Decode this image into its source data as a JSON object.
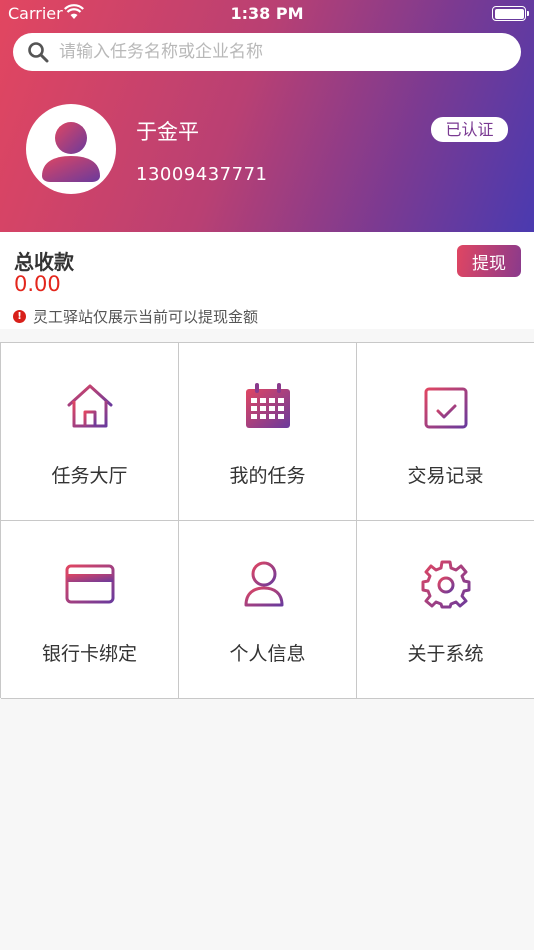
{
  "status_bar": {
    "carrier": "Carrier",
    "time": "1:38 PM"
  },
  "search": {
    "placeholder": "请输入任务名称或企业名称",
    "icon": "search-icon"
  },
  "profile": {
    "name": "于金平",
    "phone": "13009437771",
    "badge": "已认证",
    "avatar_icon": "user-avatar-icon"
  },
  "balance": {
    "label": "总收款",
    "amount": "0.00",
    "withdraw_label": "提现",
    "notice_mark": "!",
    "notice": "灵工驿站仅展示当前可以提现金额"
  },
  "menu": [
    {
      "label": "任务大厅",
      "icon": "home-icon"
    },
    {
      "label": "我的任务",
      "icon": "calendar-icon"
    },
    {
      "label": "交易记录",
      "icon": "calendar-check-icon"
    },
    {
      "label": "银行卡绑定",
      "icon": "credit-card-icon"
    },
    {
      "label": "个人信息",
      "icon": "user-info-icon"
    },
    {
      "label": "关于系统",
      "icon": "gear-icon"
    }
  ],
  "colors": {
    "gradient_start": "#e24660",
    "gradient_end": "#4a3ab0",
    "accent_red": "#e3261c",
    "icon_start": "#e04662",
    "icon_end": "#6a3a9c"
  }
}
